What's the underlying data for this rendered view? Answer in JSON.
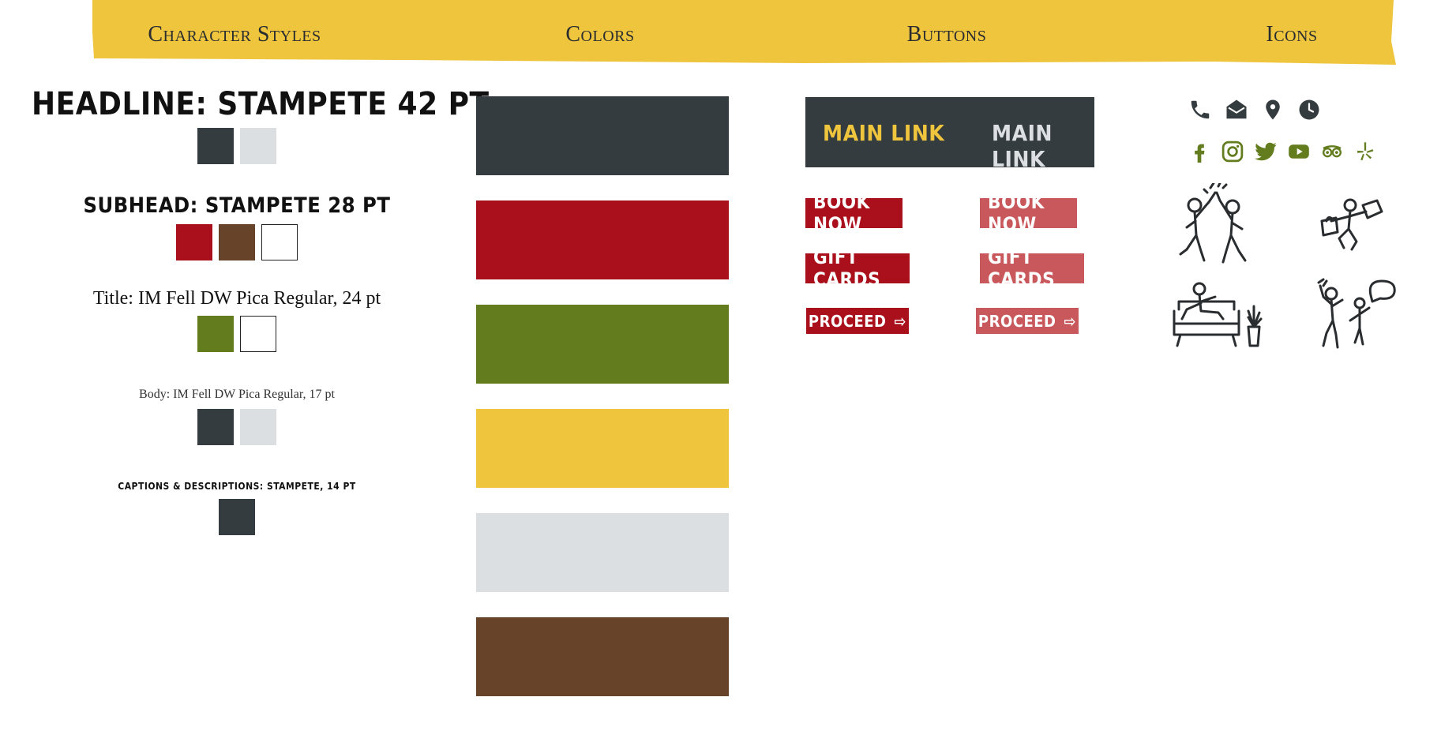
{
  "header": {
    "character_styles": "Character Styles",
    "colors": "Colors",
    "buttons": "Buttons",
    "icons": "Icons",
    "bg_color": "#eec53d"
  },
  "character_styles": {
    "headline": "HEADLINE: STAMPETE 42 PT",
    "subhead": "SUBHEAD: STAMPETE 28 PT",
    "title": "Title: IM Fell DW Pica Regular, 24 pt",
    "body": "Body: IM Fell DW Pica Regular, 17 pt",
    "captions": "CAPTIONS & DESCRIPTIONS: STAMPETE, 14 PT",
    "headline_swatches": [
      "#353c3f",
      "#dcdfe1"
    ],
    "subhead_swatches": [
      "#aa101c",
      "#67432a",
      "#ffffff"
    ],
    "title_swatches": [
      "#627c1e",
      "#ffffff"
    ],
    "body_swatches": [
      "#353c3f",
      "#dcdfe1"
    ],
    "caption_swatches": [
      "#353c3f"
    ]
  },
  "colors": {
    "palette": [
      "#353c3f",
      "#aa101c",
      "#627c1e",
      "#eec53d",
      "#dcdfe1",
      "#67432a"
    ]
  },
  "buttons": {
    "main_link_active": "MAIN LINK",
    "main_link_default": "MAIN LINK",
    "book_now": "BOOK NOW",
    "book_now_hover": "BOOK NOW",
    "gift_cards": "GIFT CARDS",
    "gift_cards_hover": "GIFT CARDS",
    "proceed": "PROCEED",
    "proceed_hover": "PROCEED",
    "arrow_glyph": "⇨",
    "primary_color": "#aa101c",
    "hover_color": "#c9585d",
    "nav_bg": "#353c3f",
    "active_link_color": "#eec53d",
    "default_link_color": "#dcdfe1"
  },
  "icons": {
    "contact": [
      "phone-icon",
      "envelope-icon",
      "map-pin-icon",
      "clock-icon"
    ],
    "social": [
      "facebook-icon",
      "instagram-icon",
      "twitter-icon",
      "youtube-icon",
      "tripadvisor-icon",
      "yelp-icon"
    ],
    "illustrations": [
      "high-five-illustration",
      "shopping-illustration",
      "couch-relaxing-illustration",
      "talking-illustration"
    ],
    "contact_color": "#353c3f",
    "social_color": "#627c1e"
  }
}
